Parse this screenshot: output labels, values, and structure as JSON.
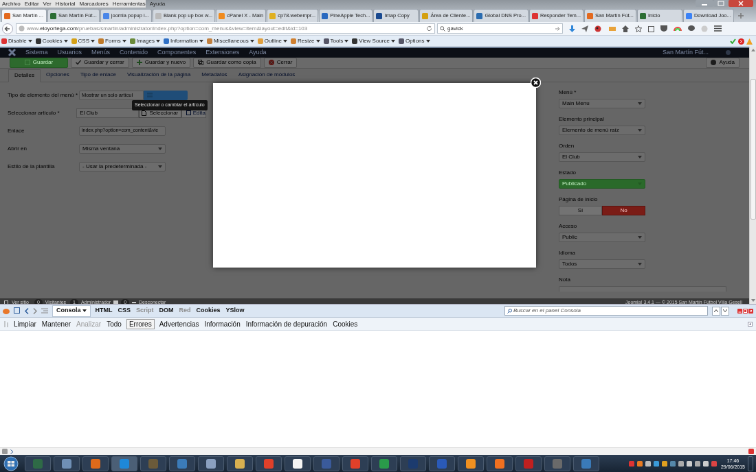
{
  "menu_bar": [
    "Archivo",
    "Editar",
    "Ver",
    "Historial",
    "Marcadores",
    "Herramientas",
    "Ayuda"
  ],
  "browser_tabs": [
    {
      "title": "San Martín ...",
      "selected": true
    },
    {
      "title": "San Martín Fút...",
      "selected": false
    },
    {
      "title": "joomla popup i...",
      "selected": false
    },
    {
      "title": "Blank pop up box w...",
      "selected": false
    },
    {
      "title": "cPanel X - Main",
      "selected": false
    },
    {
      "title": "cp78.webempr...",
      "selected": false
    },
    {
      "title": "PineApple Tech...",
      "selected": false
    },
    {
      "title": "Imap Copy",
      "selected": false
    },
    {
      "title": "Área de Cliente...",
      "selected": false
    },
    {
      "title": "Global DNS Pro...",
      "selected": false
    },
    {
      "title": "Responder Tem...",
      "selected": false
    },
    {
      "title": "San Martín Fút...",
      "selected": false
    },
    {
      "title": "Inicio",
      "selected": false
    },
    {
      "title": "Download Joo...",
      "selected": false
    }
  ],
  "address_bar": {
    "url": "www.**eloyortega.com**/pruebas/smartin/administrator/index.php?option=com_menus&view=item&layout=edit&id=103"
  },
  "search_bar": {
    "value": "gavick"
  },
  "addon_toolbar": [
    "Disable",
    "Cookies",
    "CSS",
    "Forms",
    "Images",
    "Information",
    "Miscellaneous",
    "Outline",
    "Resize",
    "Tools",
    "View Source",
    "Options"
  ],
  "admin_nav": {
    "items": [
      "Sistema",
      "Usuarios",
      "Menús",
      "Contenido",
      "Componentes",
      "Extensiones",
      "Ayuda"
    ],
    "site": "San Martín Fút..."
  },
  "toolbar": [
    {
      "label": "Guardar",
      "kind": "save"
    },
    {
      "label": "Guardar y cerrar",
      "kind": "check"
    },
    {
      "label": "Guardar y nuevo",
      "kind": "plus"
    },
    {
      "label": "Guardar como copia",
      "kind": "copy"
    },
    {
      "label": "Cerrar",
      "kind": "close"
    }
  ],
  "help_button": "Ayuda",
  "tabs": [
    {
      "label": "Detalles",
      "selected": true
    },
    {
      "label": "Opciones",
      "selected": false
    },
    {
      "label": "Tipo de enlace",
      "selected": false
    },
    {
      "label": "Visualización de la página",
      "selected": false
    },
    {
      "label": "Metadatos",
      "selected": false
    },
    {
      "label": "Asignación de módulos",
      "selected": false
    }
  ],
  "left_fields": [
    {
      "label": "Tipo de elemento del menú *",
      "value": "Mostrar un solo artícul",
      "kind": "picker"
    },
    {
      "label": "Seleccionar artículo *",
      "value": "El Club",
      "kind": "article",
      "button": "Seleccionar",
      "edit": "Edita"
    },
    {
      "label": "Enlace",
      "value": "index.php?option=com_content&vie",
      "kind": "text"
    },
    {
      "label": "Abrir en",
      "value": "Misma ventana",
      "kind": "select"
    },
    {
      "label": "Estilo de la plantilla",
      "value": "- Usar la predeterminada -",
      "kind": "select"
    }
  ],
  "tooltip": "Seleccionar o cambiar el artículo",
  "right_fields": [
    {
      "label": "Menú *",
      "value": "Main Menu",
      "kind": "select"
    },
    {
      "label": "Elemento principal",
      "value": "Elemento de menú raíz",
      "kind": "select"
    },
    {
      "label": "Orden",
      "value": "El Club",
      "kind": "select"
    },
    {
      "label": "Estado",
      "value": "Publicado",
      "kind": "status"
    },
    {
      "label": "Página de inicio",
      "kind": "toggle",
      "options": [
        {
          "label": "Sí",
          "selected": false
        },
        {
          "label": "No",
          "selected": true
        }
      ]
    },
    {
      "label": "Acceso",
      "value": "Public",
      "kind": "select"
    },
    {
      "label": "Idioma",
      "value": "Todos",
      "kind": "select"
    },
    {
      "label": "Nota",
      "kind": "text"
    }
  ],
  "status_bar": {
    "view_site": "Ver sitio",
    "visitors_count": "0",
    "visitors": "Visitantes",
    "admins_count": "1",
    "admins": "Administrador",
    "messages_count": "0",
    "logout": "Desconectar",
    "footer": "Joomla! 3.4.1 — © 2015 San Martín Fútbol Villa Gesell"
  },
  "firebug": {
    "tabs": [
      {
        "label": "Consola",
        "selected": true,
        "disabled": false
      },
      {
        "label": "HTML",
        "selected": false,
        "disabled": false
      },
      {
        "label": "CSS",
        "selected": false,
        "disabled": false
      },
      {
        "label": "Script",
        "selected": false,
        "disabled": true
      },
      {
        "label": "DOM",
        "selected": false,
        "disabled": false
      },
      {
        "label": "Red",
        "selected": false,
        "disabled": true
      },
      {
        "label": "Cookies",
        "selected": false,
        "disabled": false
      },
      {
        "label": "YSlow",
        "selected": false,
        "disabled": false
      }
    ],
    "search_placeholder": "Buscar en el panel Consola",
    "filters": [
      {
        "label": "Limpiar",
        "selected": false,
        "disabled": false
      },
      {
        "label": "Mantener",
        "selected": false,
        "disabled": false
      },
      {
        "label": "Analizar",
        "selected": false,
        "disabled": true
      },
      {
        "label": "Todo",
        "selected": false,
        "disabled": false
      },
      {
        "label": "Errores",
        "selected": true,
        "disabled": false
      },
      {
        "label": "Advertencias",
        "selected": false,
        "disabled": false
      },
      {
        "label": "Información",
        "selected": false,
        "disabled": false
      },
      {
        "label": "Información de depuración",
        "selected": false,
        "disabled": false
      },
      {
        "label": "Cookies",
        "selected": false,
        "disabled": false
      }
    ]
  },
  "clock": {
    "time": "17:46",
    "date": "29/06/2015"
  }
}
